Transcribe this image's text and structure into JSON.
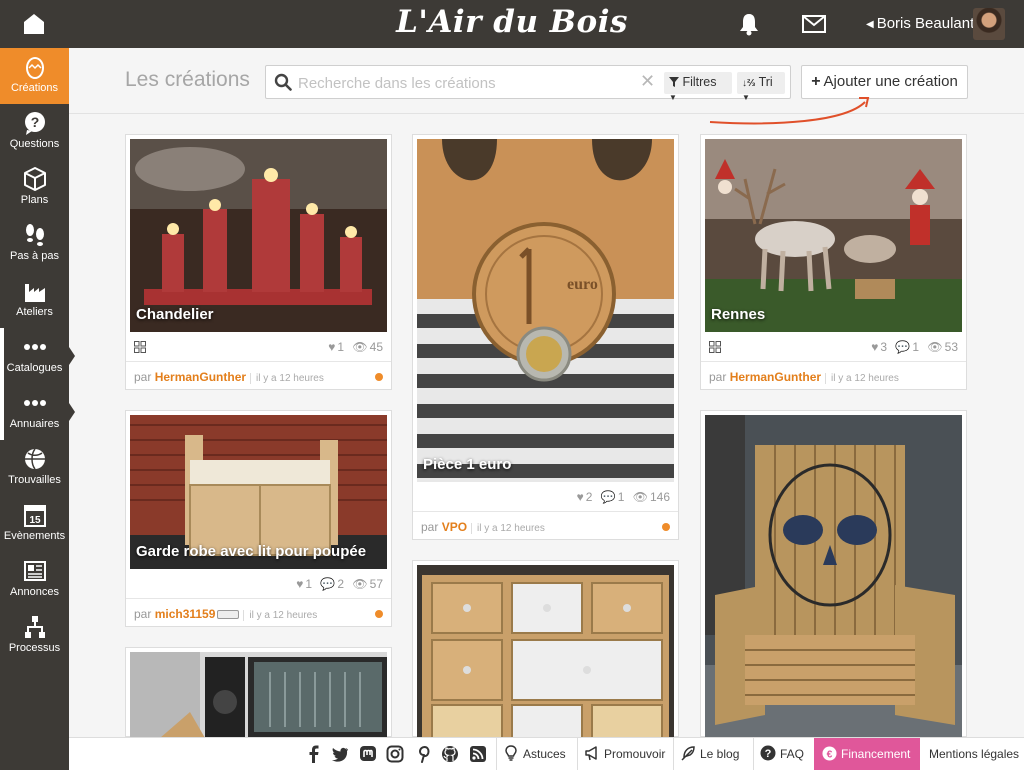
{
  "header": {
    "logo_text": "L'Air du Bois",
    "user_name": "Boris Beaulant",
    "icons": [
      "home-icon",
      "bell-icon",
      "mail-icon"
    ]
  },
  "sidebar": {
    "items": [
      {
        "label": "Créations",
        "icon": "egg-icon",
        "active": true
      },
      {
        "label": "Questions",
        "icon": "question-icon"
      },
      {
        "label": "Plans",
        "icon": "cube-icon"
      },
      {
        "label": "Pas à pas",
        "icon": "footsteps-icon"
      },
      {
        "label": "Ateliers",
        "icon": "factory-icon"
      },
      {
        "label": "Catalogues",
        "icon": "dots-icon"
      },
      {
        "label": "Annuaires",
        "icon": "dots-icon"
      },
      {
        "label": "Trouvailles",
        "icon": "globe-icon"
      },
      {
        "label": "Evènements",
        "icon": "calendar-icon",
        "calendar_day": "15"
      },
      {
        "label": "Annonces",
        "icon": "newspaper-icon"
      },
      {
        "label": "Processus",
        "icon": "flow-icon"
      }
    ]
  },
  "page": {
    "title": "Les créations",
    "search_placeholder": "Recherche dans les créations",
    "clear_symbol": "✕",
    "filter_label": "Filtres",
    "sort_label": "Tri",
    "add_button_label": "Ajouter une création"
  },
  "cards": [
    {
      "title": "Chandelier",
      "likes": "1",
      "comments": "",
      "views": "45",
      "author": "HermanGunther",
      "time": "il y a 12 heures",
      "by": "par"
    },
    {
      "title": "Pièce 1 euro",
      "likes": "2",
      "comments": "1",
      "views": "146",
      "author": "VPO",
      "time": "il y a 12 heures",
      "by": "par"
    },
    {
      "title": "Rennes",
      "likes": "3",
      "comments": "1",
      "views": "53",
      "author": "HermanGunther",
      "time": "il y a 12 heures",
      "by": "par"
    },
    {
      "title": "Garde robe avec lit pour poupée",
      "likes": "1",
      "comments": "2",
      "views": "57",
      "author": "mich31159",
      "time": "il y a 12 heures",
      "by": "par"
    },
    {
      "title": "",
      "likes": "",
      "comments": "",
      "views": "",
      "author": "",
      "time": ""
    },
    {
      "title": "",
      "likes": "",
      "comments": "",
      "views": "",
      "author": "",
      "time": ""
    },
    {
      "title": "",
      "likes": "",
      "comments": "",
      "views": "",
      "author": "",
      "time": ""
    }
  ],
  "footer": {
    "social": [
      "facebook-icon",
      "twitter-icon",
      "mastodon-icon",
      "instagram-icon",
      "pinterest-icon",
      "github-icon",
      "rss-icon"
    ],
    "links": {
      "tips": "Astuces",
      "promote": "Promouvoir",
      "blog": "Le blog",
      "faq": "FAQ",
      "funding": "Financement",
      "legal": "Mentions légales"
    }
  },
  "colors": {
    "accent": "#ef8c2a",
    "dark": "#3d3a36",
    "funding": "#e0579a",
    "author": "#e37f1c"
  }
}
